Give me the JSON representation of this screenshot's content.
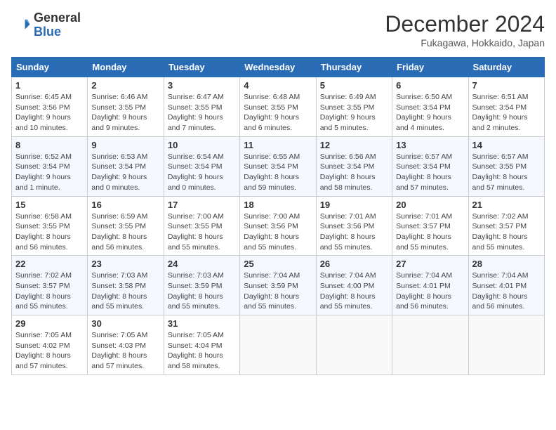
{
  "header": {
    "logo_general": "General",
    "logo_blue": "Blue",
    "month_title": "December 2024",
    "subtitle": "Fukagawa, Hokkaido, Japan"
  },
  "weekdays": [
    "Sunday",
    "Monday",
    "Tuesday",
    "Wednesday",
    "Thursday",
    "Friday",
    "Saturday"
  ],
  "weeks": [
    [
      {
        "day": 1,
        "info": "Sunrise: 6:45 AM\nSunset: 3:56 PM\nDaylight: 9 hours and 10 minutes."
      },
      {
        "day": 2,
        "info": "Sunrise: 6:46 AM\nSunset: 3:55 PM\nDaylight: 9 hours and 9 minutes."
      },
      {
        "day": 3,
        "info": "Sunrise: 6:47 AM\nSunset: 3:55 PM\nDaylight: 9 hours and 7 minutes."
      },
      {
        "day": 4,
        "info": "Sunrise: 6:48 AM\nSunset: 3:55 PM\nDaylight: 9 hours and 6 minutes."
      },
      {
        "day": 5,
        "info": "Sunrise: 6:49 AM\nSunset: 3:55 PM\nDaylight: 9 hours and 5 minutes."
      },
      {
        "day": 6,
        "info": "Sunrise: 6:50 AM\nSunset: 3:54 PM\nDaylight: 9 hours and 4 minutes."
      },
      {
        "day": 7,
        "info": "Sunrise: 6:51 AM\nSunset: 3:54 PM\nDaylight: 9 hours and 2 minutes."
      }
    ],
    [
      {
        "day": 8,
        "info": "Sunrise: 6:52 AM\nSunset: 3:54 PM\nDaylight: 9 hours and 1 minute."
      },
      {
        "day": 9,
        "info": "Sunrise: 6:53 AM\nSunset: 3:54 PM\nDaylight: 9 hours and 0 minutes."
      },
      {
        "day": 10,
        "info": "Sunrise: 6:54 AM\nSunset: 3:54 PM\nDaylight: 9 hours and 0 minutes."
      },
      {
        "day": 11,
        "info": "Sunrise: 6:55 AM\nSunset: 3:54 PM\nDaylight: 8 hours and 59 minutes."
      },
      {
        "day": 12,
        "info": "Sunrise: 6:56 AM\nSunset: 3:54 PM\nDaylight: 8 hours and 58 minutes."
      },
      {
        "day": 13,
        "info": "Sunrise: 6:57 AM\nSunset: 3:54 PM\nDaylight: 8 hours and 57 minutes."
      },
      {
        "day": 14,
        "info": "Sunrise: 6:57 AM\nSunset: 3:55 PM\nDaylight: 8 hours and 57 minutes."
      }
    ],
    [
      {
        "day": 15,
        "info": "Sunrise: 6:58 AM\nSunset: 3:55 PM\nDaylight: 8 hours and 56 minutes."
      },
      {
        "day": 16,
        "info": "Sunrise: 6:59 AM\nSunset: 3:55 PM\nDaylight: 8 hours and 56 minutes."
      },
      {
        "day": 17,
        "info": "Sunrise: 7:00 AM\nSunset: 3:55 PM\nDaylight: 8 hours and 55 minutes."
      },
      {
        "day": 18,
        "info": "Sunrise: 7:00 AM\nSunset: 3:56 PM\nDaylight: 8 hours and 55 minutes."
      },
      {
        "day": 19,
        "info": "Sunrise: 7:01 AM\nSunset: 3:56 PM\nDaylight: 8 hours and 55 minutes."
      },
      {
        "day": 20,
        "info": "Sunrise: 7:01 AM\nSunset: 3:57 PM\nDaylight: 8 hours and 55 minutes."
      },
      {
        "day": 21,
        "info": "Sunrise: 7:02 AM\nSunset: 3:57 PM\nDaylight: 8 hours and 55 minutes."
      }
    ],
    [
      {
        "day": 22,
        "info": "Sunrise: 7:02 AM\nSunset: 3:57 PM\nDaylight: 8 hours and 55 minutes."
      },
      {
        "day": 23,
        "info": "Sunrise: 7:03 AM\nSunset: 3:58 PM\nDaylight: 8 hours and 55 minutes."
      },
      {
        "day": 24,
        "info": "Sunrise: 7:03 AM\nSunset: 3:59 PM\nDaylight: 8 hours and 55 minutes."
      },
      {
        "day": 25,
        "info": "Sunrise: 7:04 AM\nSunset: 3:59 PM\nDaylight: 8 hours and 55 minutes."
      },
      {
        "day": 26,
        "info": "Sunrise: 7:04 AM\nSunset: 4:00 PM\nDaylight: 8 hours and 55 minutes."
      },
      {
        "day": 27,
        "info": "Sunrise: 7:04 AM\nSunset: 4:01 PM\nDaylight: 8 hours and 56 minutes."
      },
      {
        "day": 28,
        "info": "Sunrise: 7:04 AM\nSunset: 4:01 PM\nDaylight: 8 hours and 56 minutes."
      }
    ],
    [
      {
        "day": 29,
        "info": "Sunrise: 7:05 AM\nSunset: 4:02 PM\nDaylight: 8 hours and 57 minutes."
      },
      {
        "day": 30,
        "info": "Sunrise: 7:05 AM\nSunset: 4:03 PM\nDaylight: 8 hours and 57 minutes."
      },
      {
        "day": 31,
        "info": "Sunrise: 7:05 AM\nSunset: 4:04 PM\nDaylight: 8 hours and 58 minutes."
      },
      null,
      null,
      null,
      null
    ]
  ]
}
